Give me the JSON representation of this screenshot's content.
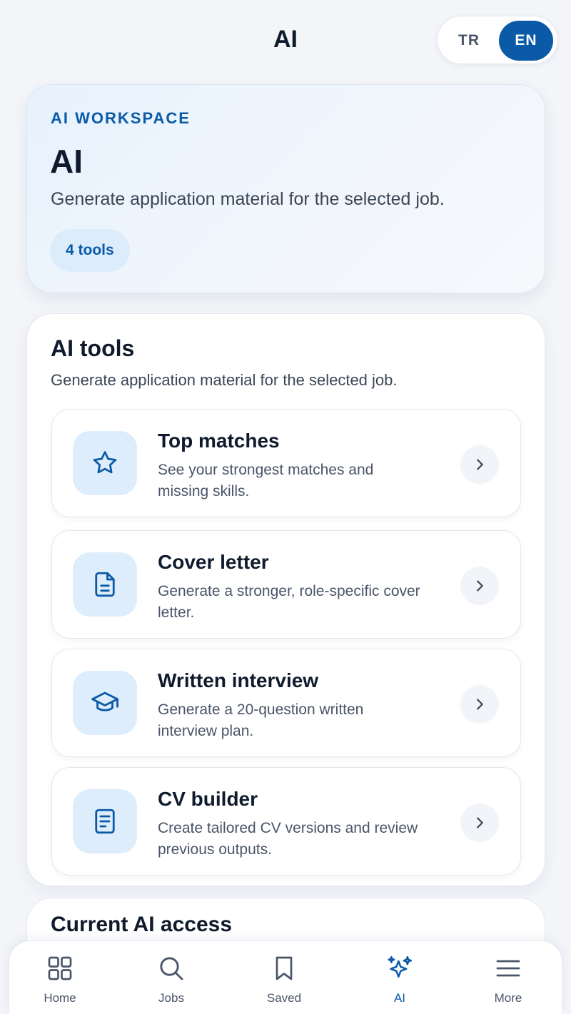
{
  "header": {
    "title": "AI",
    "language": {
      "options": [
        "TR",
        "EN"
      ],
      "selected": "EN"
    }
  },
  "hero": {
    "eyebrow": "AI WORKSPACE",
    "title": "AI",
    "description": "Generate application material for the selected job.",
    "badge": "4 tools"
  },
  "tools": {
    "title": "AI tools",
    "subtitle": "Generate application material for the selected job.",
    "items": [
      {
        "name": "Top matches",
        "description": "See your strongest matches and missing skills.",
        "icon": "star-icon"
      },
      {
        "name": "Cover letter",
        "description": "Generate a stronger, role-specific cover letter.",
        "icon": "document-icon"
      },
      {
        "name": "Written interview",
        "description": "Generate a 20-question written interview plan.",
        "icon": "graduation-cap-icon"
      },
      {
        "name": "CV builder",
        "description": "Create tailored CV versions and review previous outputs.",
        "icon": "cv-document-icon"
      }
    ]
  },
  "access": {
    "title": "Current AI access"
  },
  "nav": {
    "items": [
      {
        "label": "Home",
        "icon": "grid-icon"
      },
      {
        "label": "Jobs",
        "icon": "search-icon"
      },
      {
        "label": "Saved",
        "icon": "bookmark-icon"
      },
      {
        "label": "AI",
        "icon": "sparkles-icon"
      },
      {
        "label": "More",
        "icon": "menu-icon"
      }
    ],
    "active": "AI"
  },
  "colors": {
    "accent": "#0b5aa8",
    "icon_bg": "#deedfb",
    "text_primary": "#0f1b2d",
    "text_secondary": "#4a5568"
  }
}
